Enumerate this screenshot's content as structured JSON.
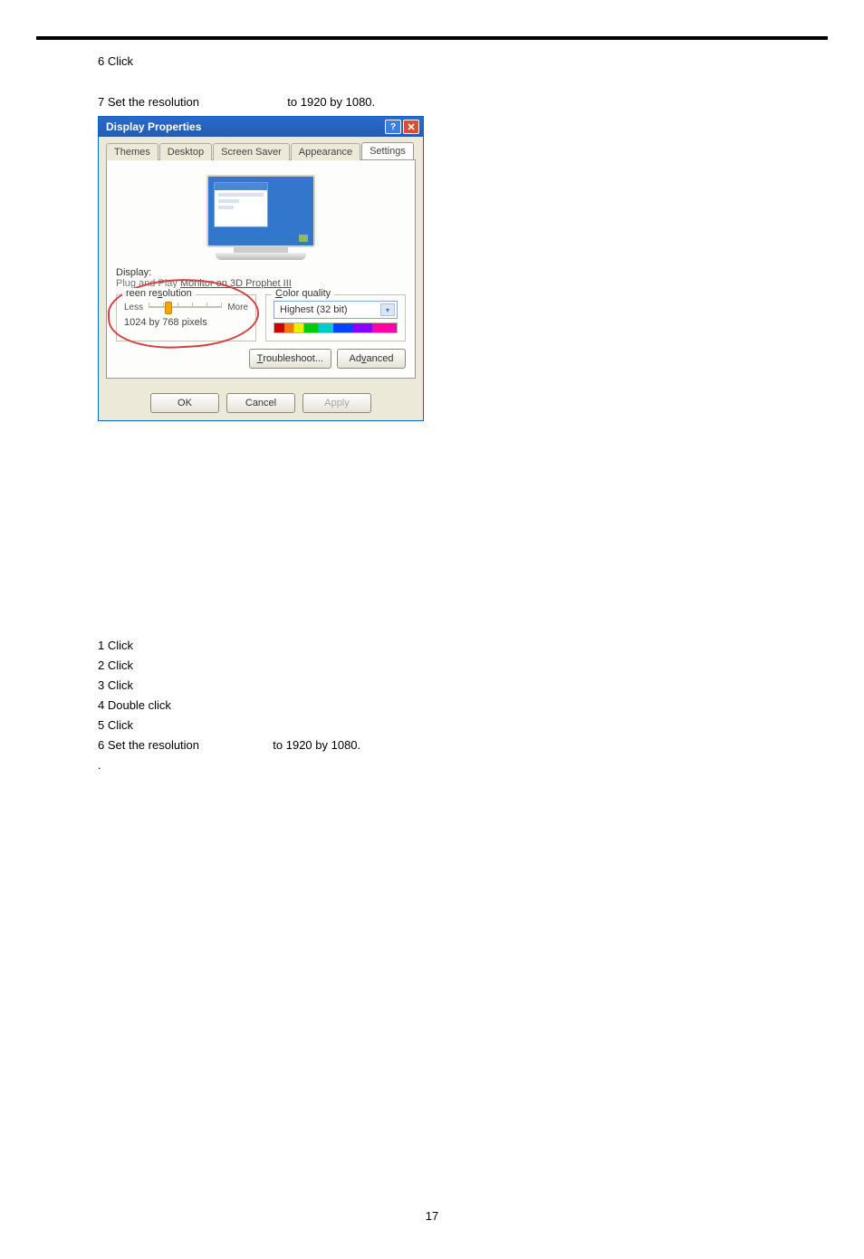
{
  "page_number": "17",
  "upper_steps": {
    "step6": "6 Click",
    "step7_pre": "7 Set the resolution",
    "step7_post": "to 1920 by 1080."
  },
  "dialog": {
    "title": "Display Properties",
    "tabs": {
      "themes": "Themes",
      "desktop": "Desktop",
      "screensaver": "Screen Saver",
      "appearance": "Appearance",
      "settings": "Settings"
    },
    "display_label": "Display:",
    "monitor_text_pre": "Plug and Play ",
    "monitor_text_link": "Monitor on 3D Prophet III",
    "screen_res_legend_pre": "reen re",
    "screen_res_legend_post": "olution",
    "less": "Less",
    "more": "More",
    "res_value": "1024 by 768 pixels",
    "color_quality_legend_pre": "C",
    "color_quality_legend_post": "olor quality",
    "color_quality_value": "Highest (32 bit)",
    "troubleshoot_pre": "T",
    "troubleshoot_post": "roubleshoot...",
    "advanced_pre": "Ad",
    "advanced_u": "v",
    "advanced_post": "anced",
    "ok": "OK",
    "cancel": "Cancel",
    "apply": "Apply"
  },
  "lower_steps": {
    "s1": "1 Click",
    "s2": "2 Click",
    "s3": "3 Click",
    "s4": "4 Double click",
    "s5": "5 Click",
    "s6_pre": "6 Set the resolution",
    "s6_post": "to 1920 by 1080",
    "dot": "."
  }
}
